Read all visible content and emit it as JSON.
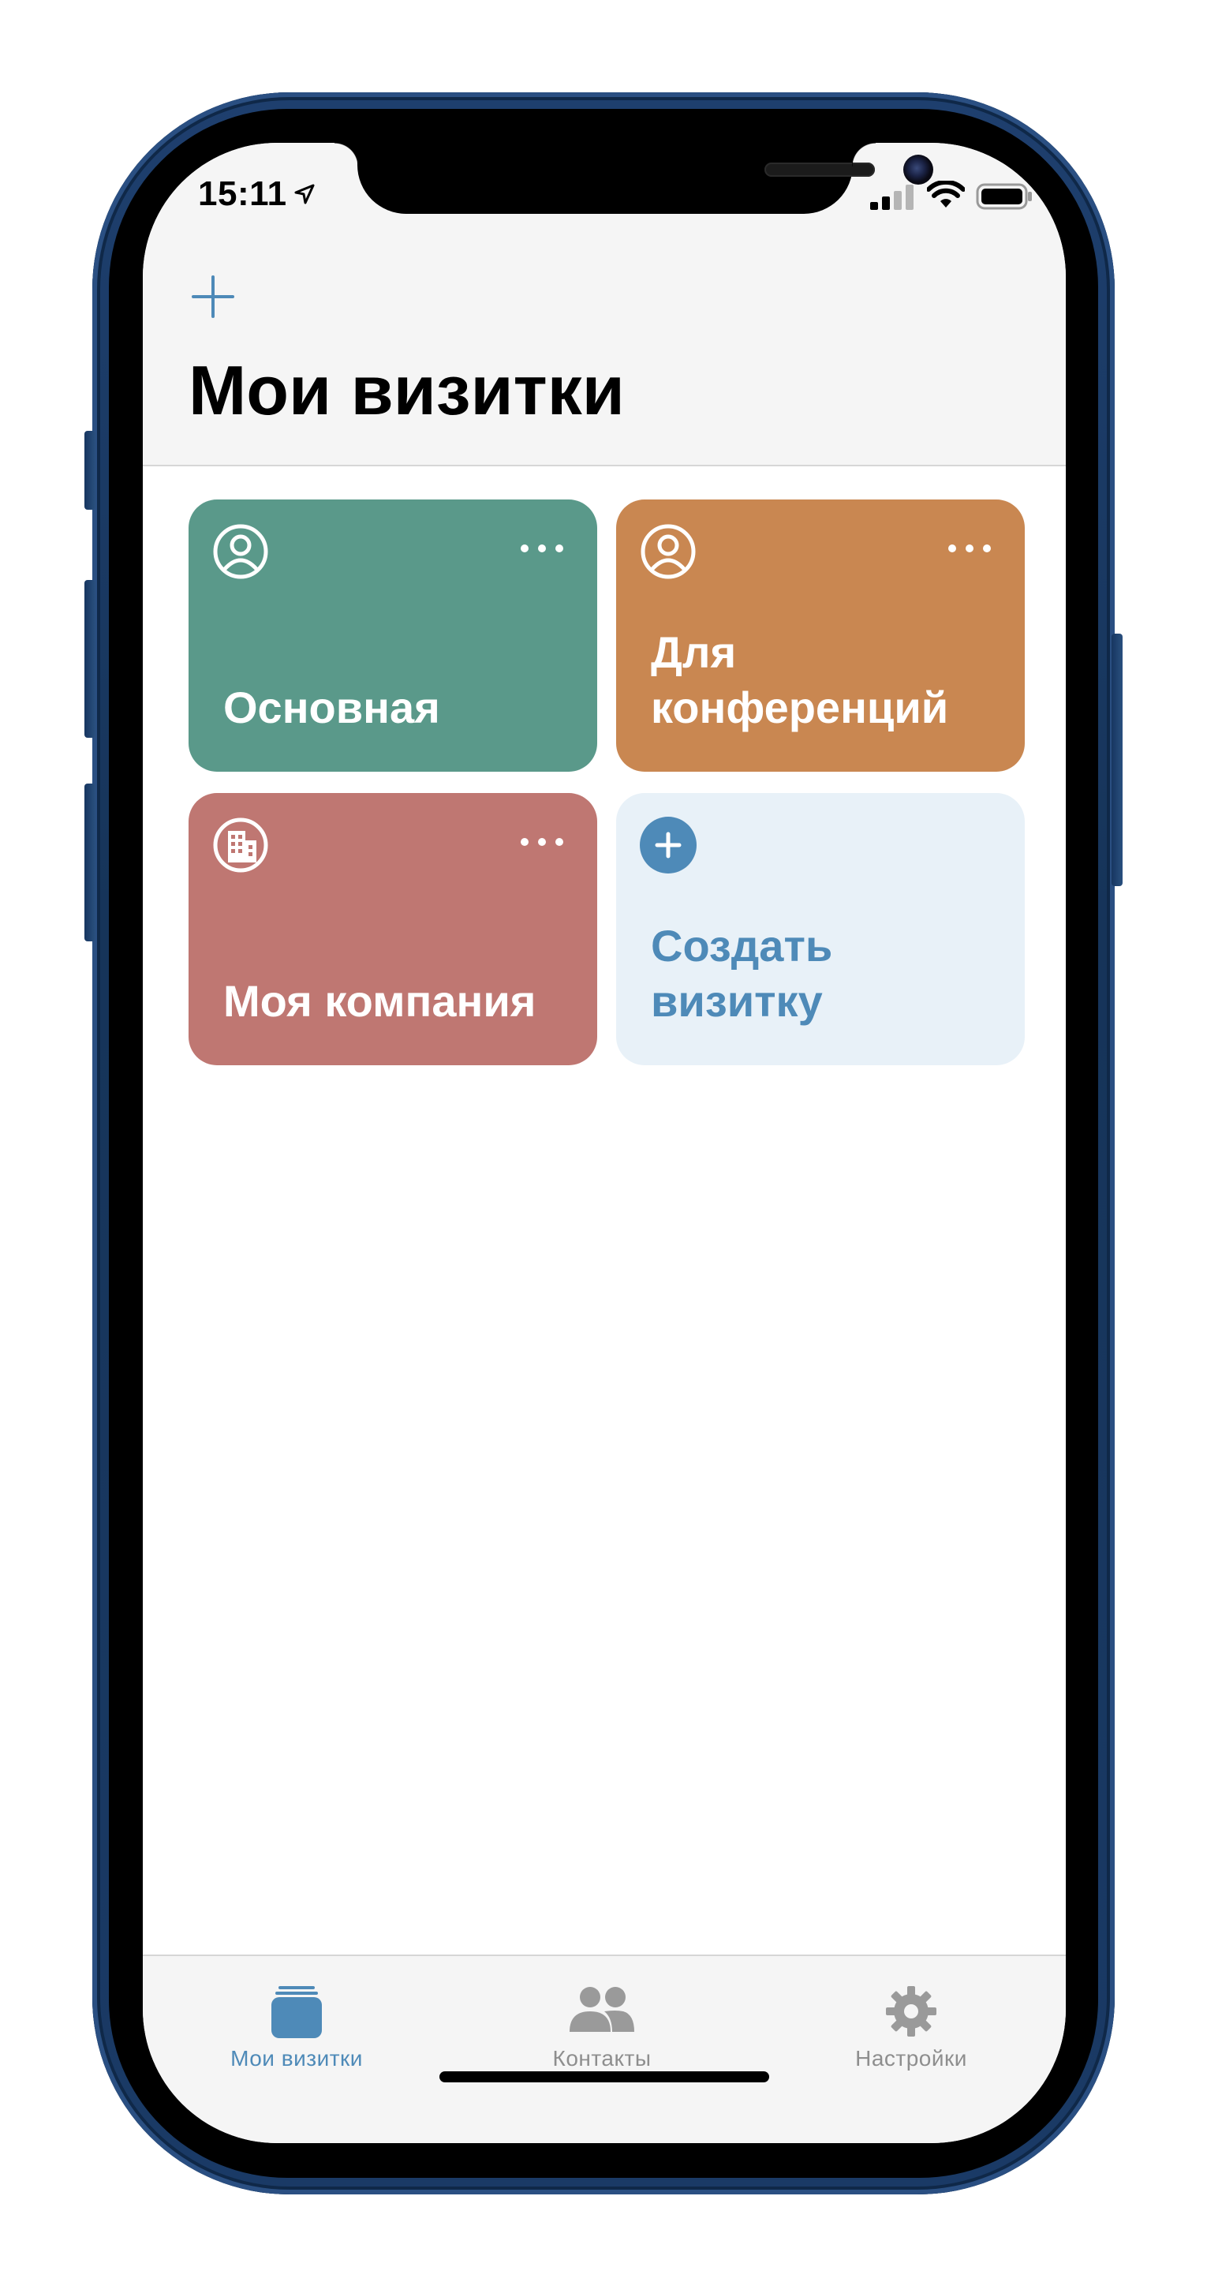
{
  "status_bar": {
    "time": "15:11",
    "location_icon": "location-arrow-icon",
    "signal_icon": "cellular-signal-icon",
    "wifi_icon": "wifi-icon",
    "battery_icon": "battery-icon"
  },
  "header": {
    "add_icon": "plus-icon",
    "title": "Мои визитки"
  },
  "cards": [
    {
      "label": "Основная",
      "icon": "person-circle-icon",
      "color": "#5a998a",
      "has_menu": true
    },
    {
      "label": "Для конференций",
      "icon": "person-circle-icon",
      "color": "#c98751",
      "has_menu": true
    },
    {
      "label": "Моя компания",
      "icon": "building-circle-icon",
      "color": "#bf7772",
      "has_menu": true
    },
    {
      "label": "Создать визитку",
      "icon": "plus-circle-icon",
      "color": "#e8f1f8",
      "text_color": "#4e8ab8",
      "has_menu": false
    }
  ],
  "tabbar": {
    "tabs": [
      {
        "label": "Мои визитки",
        "icon": "cards-stack-icon",
        "active": true
      },
      {
        "label": "Контакты",
        "icon": "people-icon",
        "active": false
      },
      {
        "label": "Настройки",
        "icon": "gear-icon",
        "active": false
      }
    ],
    "active_color": "#4e8ab8",
    "inactive_color": "#8e8e8e"
  },
  "colors": {
    "accent": "#4e8ab8",
    "phone_frame": "#1e3f6e"
  }
}
